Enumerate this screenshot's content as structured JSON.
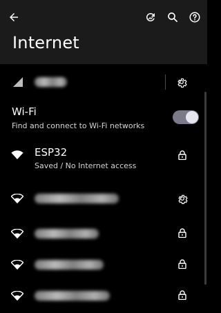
{
  "header": {
    "title": "Internet",
    "back_icon": "arrow-back-icon",
    "refresh_icon": "refresh-icon",
    "search_icon": "search-icon",
    "help_icon": "help-icon"
  },
  "mobile": {
    "signal_icon": "cellular-signal-icon",
    "settings_icon": "gear-icon"
  },
  "wifi": {
    "title": "Wi-Fi",
    "subtitle": "Find and connect to Wi-Fi networks",
    "enabled": true
  },
  "networks": [
    {
      "name": "ESP32",
      "status": "Saved / No Internet access",
      "secured": true,
      "action_icon": "lock-icon"
    },
    {
      "name": "",
      "status": "",
      "secured": false,
      "action_icon": "gear-icon"
    },
    {
      "name": "",
      "status": "",
      "secured": true,
      "action_icon": "lock-icon"
    },
    {
      "name": "",
      "status": "",
      "secured": true,
      "action_icon": "lock-icon"
    },
    {
      "name": "",
      "status": "",
      "secured": true,
      "action_icon": "lock-icon"
    }
  ],
  "colors": {
    "header_bg": "#1b1b1b",
    "page_bg": "#000000",
    "toggle_track": "#7a7a88",
    "toggle_knob": "#e6e6f0"
  }
}
